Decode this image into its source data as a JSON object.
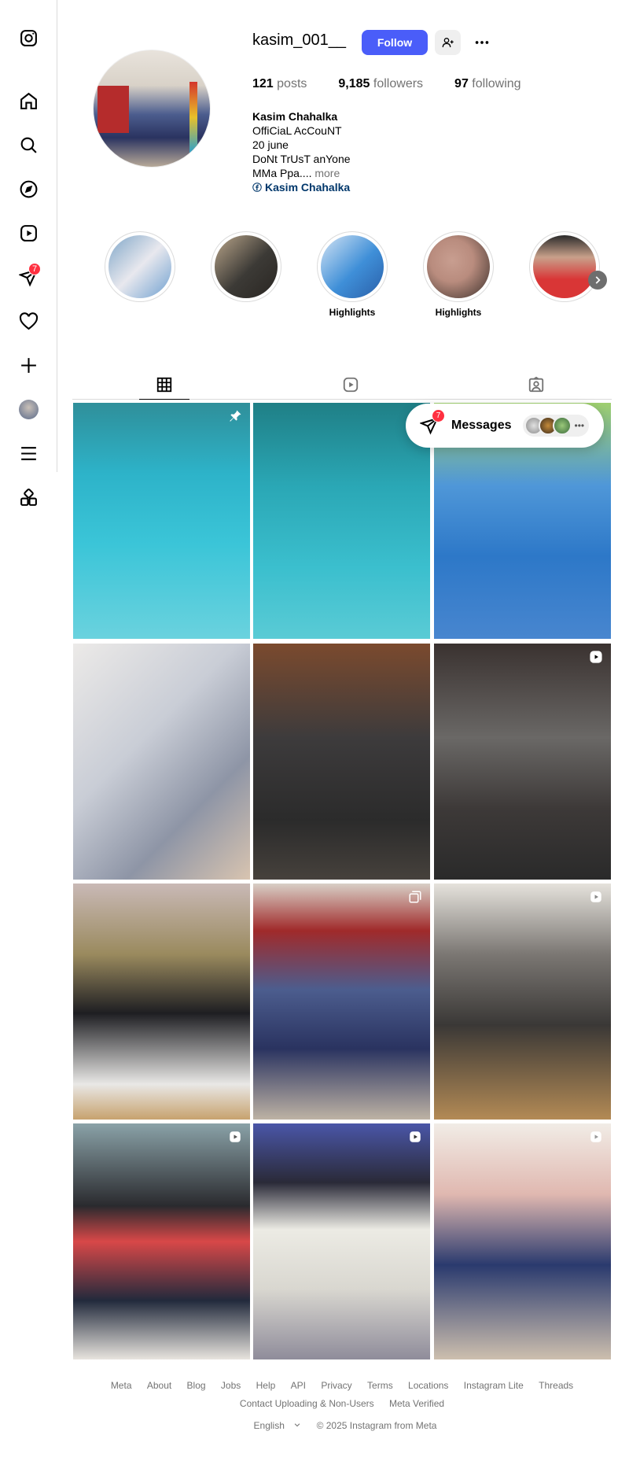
{
  "sidebar": {
    "items": [
      {
        "name": "instagram-logo-icon"
      },
      {
        "name": "home-icon"
      },
      {
        "name": "search-icon"
      },
      {
        "name": "explore-icon"
      },
      {
        "name": "reels-icon"
      },
      {
        "name": "messages-icon",
        "badge": "7"
      },
      {
        "name": "notifications-icon"
      },
      {
        "name": "create-icon"
      },
      {
        "name": "profile-avatar"
      },
      {
        "name": "more-menu-icon"
      },
      {
        "name": "also-from-meta-icon"
      }
    ]
  },
  "profile": {
    "username": "kasim_001__",
    "follow_label": "Follow",
    "stats": {
      "posts_count": "121",
      "posts_label": "posts",
      "followers_count": "9,185",
      "followers_label": "followers",
      "following_count": "97",
      "following_label": "following"
    },
    "bio": {
      "name": "Kasim Chahalka",
      "lines": [
        "OffiCiaL AcCouNT",
        "20 june",
        "DoNt TrUsT anYone",
        "MMa Ppa.... "
      ],
      "more_label": "more",
      "link_label": "Kasim Chahalka"
    }
  },
  "highlights": [
    {
      "label": "",
      "colors": [
        "#7fa6c8",
        "#e8e8ee"
      ]
    },
    {
      "label": "",
      "colors": [
        "#3c3a36",
        "#b9a58a"
      ]
    },
    {
      "label": "Highlights",
      "colors": [
        "#3f8fd8",
        "#d4e4f4"
      ]
    },
    {
      "label": "Highlights",
      "colors": [
        "#b98c7e",
        "#3a2f2a"
      ]
    },
    {
      "label": "",
      "colors": [
        "#d93636",
        "#2b2b2b"
      ]
    }
  ],
  "messages": {
    "label": "Messages",
    "badge": "7"
  },
  "footer": {
    "links": [
      "Meta",
      "About",
      "Blog",
      "Jobs",
      "Help",
      "API",
      "Privacy",
      "Terms",
      "Locations",
      "Instagram Lite",
      "Threads"
    ],
    "links2": [
      "Contact Uploading & Non-Users",
      "Meta Verified"
    ],
    "language": "English",
    "copyright": "© 2025 Instagram from Meta"
  },
  "colors": {
    "accent": "#4a5df9",
    "badge_red": "#ff3040",
    "muted_text": "#737373",
    "link_blue": "#00376b"
  },
  "posts": [
    {
      "badge": "pin",
      "bg": "linear-gradient(180deg,#2f8f9a 0%,#2db3c9 30%,#3bc5d8 60%,#6ad2de 100%)"
    },
    {
      "badge": "",
      "bg": "linear-gradient(180deg,#1f7f86 0%,#2aa7b5 35%,#3bbfce 70%,#5acbd5 100%)"
    },
    {
      "badge": "",
      "bg": "linear-gradient(180deg,#9fcf6e 0%,#4f97d8 35%,#2d78c8 65%,#4886cf 100%)"
    },
    {
      "badge": "",
      "bg": "linear-gradient(135deg,#eceae8 0%,#c9cdd6 40%,#8e95a6 70%,#d8c4b0 100%)"
    },
    {
      "badge": "",
      "bg": "linear-gradient(180deg,#7b4a2e 0%,#3d3b3c 40%,#2b2b2b 75%,#46413c 100%)"
    },
    {
      "badge": "reel",
      "bg": "linear-gradient(180deg,#3a3230 0%,#6a6866 40%,#3d3938 70%,#2a2a2a 100%)"
    },
    {
      "badge": "",
      "bg": "linear-gradient(180deg,#c9b9b6 0%,#9a8a5e 30%,#1e1e22 55%,#e9e8e6 85%,#c7a26e 100%)"
    },
    {
      "badge": "carousel",
      "bg": "linear-gradient(180deg,#d8cfc6 0%,#a02a2a 20%,#4c5d8e 45%,#2a3360 70%,#bdb2a4 100%)"
    },
    {
      "badge": "reel",
      "bg": "linear-gradient(180deg,#e5e2dc 0%,#7b7773 30%,#3a3836 60%,#b38a55 100%)"
    },
    {
      "badge": "reel",
      "bg": "linear-gradient(180deg,#8aa2a8 0%,#2a2a2e 35%,#d84848 50%,#222a3c 75%,#e8e4de 100%)"
    },
    {
      "badge": "reel",
      "bg": "linear-gradient(180deg,#4a56a8 0%,#2a2a38 25%,#ecebe4 45%,#d9d7d0 70%,#8f8c9a 100%)"
    },
    {
      "badge": "reel",
      "bg": "linear-gradient(180deg,#f1ece6 0%,#e0b8b0 30%,#2a3a6e 60%,#cdbfae 100%)"
    }
  ]
}
